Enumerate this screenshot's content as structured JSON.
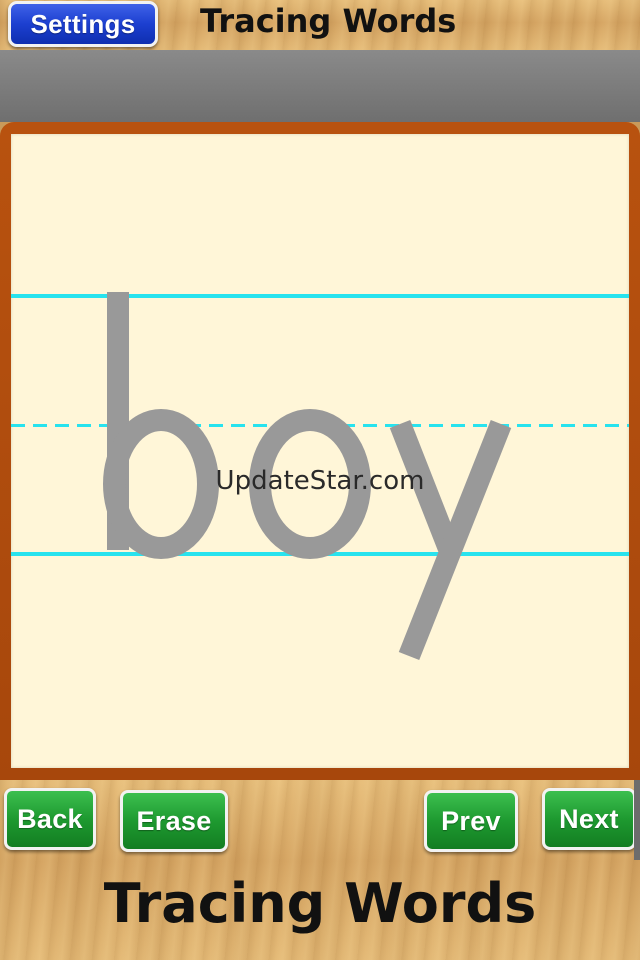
{
  "header": {
    "settings_label": "Settings",
    "title": "Tracing Words"
  },
  "tracing": {
    "word": "boy",
    "watermark": "UpdateStar.com",
    "letter_color": "#999999",
    "guide_color": "#28e3ee"
  },
  "controls": {
    "back_label": "Back",
    "erase_label": "Erase",
    "prev_label": "Prev",
    "next_label": "Next"
  },
  "footer": {
    "title": "Tracing Words"
  },
  "colors": {
    "button_green": "#1e9a30",
    "button_blue": "#1c3fd0",
    "board_frame": "#b04c0d",
    "paper": "#fff6d8"
  }
}
